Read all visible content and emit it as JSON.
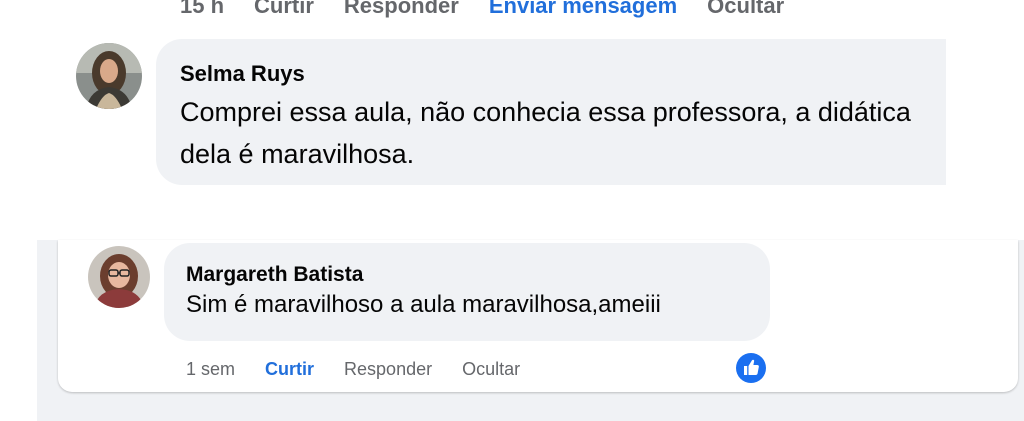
{
  "top_actions": {
    "time": "15 h",
    "like": "Curtir",
    "reply": "Responder",
    "message": "Enviar mensagem",
    "hide": "Ocultar"
  },
  "comment_1": {
    "author": "Selma Ruys",
    "text": "Comprei essa aula, não conhecia essa professora, a didática dela é maravilhosa."
  },
  "comment_2": {
    "author": "Margareth Batista",
    "text": "Sim é maravilhoso a aula maravilhosa,ameiii",
    "actions": {
      "time": "1 sem",
      "like": "Curtir",
      "reply": "Responder",
      "hide": "Ocultar"
    },
    "reaction_icon": "like-icon"
  },
  "colors": {
    "accent": "#216fdb",
    "bubble": "#f0f2f5",
    "muted": "#65676b",
    "text": "#050505"
  }
}
